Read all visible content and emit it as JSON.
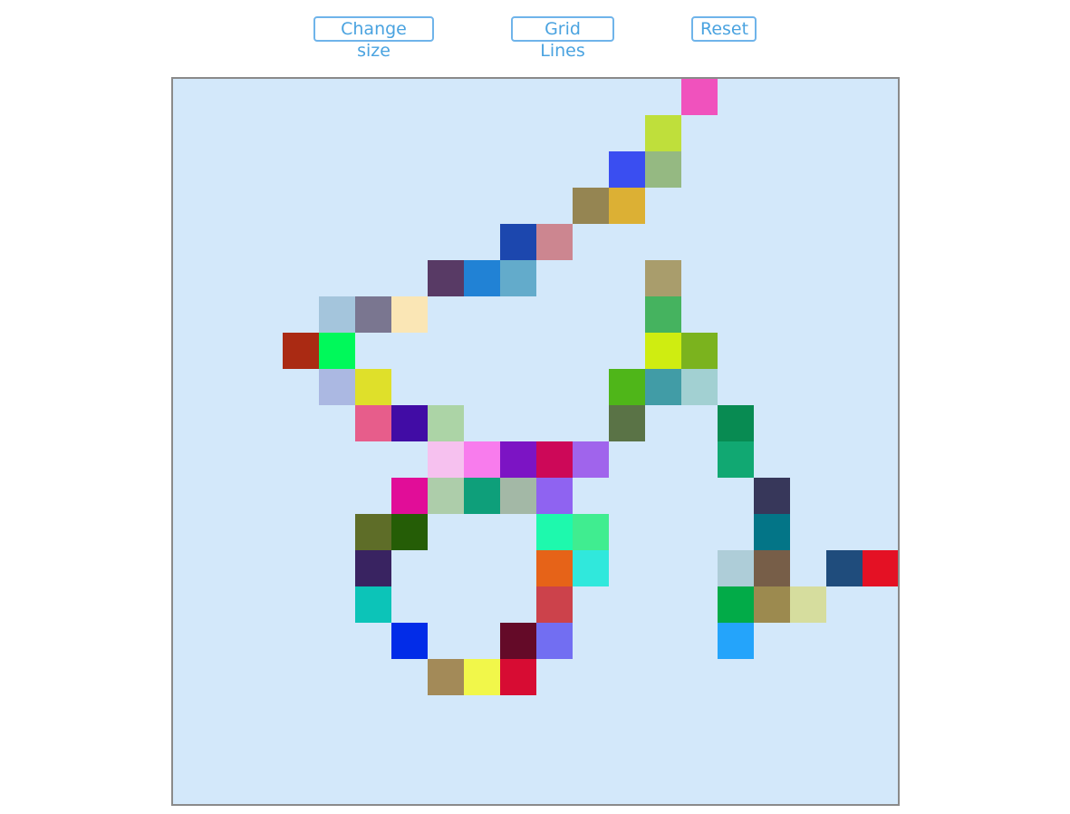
{
  "toolbar": {
    "change_size_label": "Change size",
    "grid_lines_label": "Grid Lines",
    "reset_label": "Reset"
  },
  "canvas": {
    "background_color": "#d3e8fa",
    "border_color": "#8a8a8a",
    "columns": 20,
    "rows": 20,
    "grid_lines": false,
    "painted_cells": [
      {
        "col": 14,
        "row": 0,
        "color": "#f052bd"
      },
      {
        "col": 13,
        "row": 1,
        "color": "#bfdf3b"
      },
      {
        "col": 12,
        "row": 2,
        "color": "#3a4ef1"
      },
      {
        "col": 13,
        "row": 2,
        "color": "#95b982"
      },
      {
        "col": 11,
        "row": 3,
        "color": "#958552"
      },
      {
        "col": 12,
        "row": 3,
        "color": "#dcb034"
      },
      {
        "col": 9,
        "row": 4,
        "color": "#1c47ae"
      },
      {
        "col": 10,
        "row": 4,
        "color": "#cc8690"
      },
      {
        "col": 7,
        "row": 5,
        "color": "#583a65"
      },
      {
        "col": 8,
        "row": 5,
        "color": "#2182d5"
      },
      {
        "col": 9,
        "row": 5,
        "color": "#63abcb"
      },
      {
        "col": 13,
        "row": 5,
        "color": "#a99d6c"
      },
      {
        "col": 4,
        "row": 6,
        "color": "#a4c5dc"
      },
      {
        "col": 5,
        "row": 6,
        "color": "#7a7690"
      },
      {
        "col": 6,
        "row": 6,
        "color": "#fae6b5"
      },
      {
        "col": 13,
        "row": 6,
        "color": "#45b35f"
      },
      {
        "col": 3,
        "row": 7,
        "color": "#aa2a13"
      },
      {
        "col": 4,
        "row": 7,
        "color": "#00f95a"
      },
      {
        "col": 13,
        "row": 7,
        "color": "#cfed11"
      },
      {
        "col": 14,
        "row": 7,
        "color": "#7bb31e"
      },
      {
        "col": 4,
        "row": 8,
        "color": "#abb8e2"
      },
      {
        "col": 5,
        "row": 8,
        "color": "#dfe02a"
      },
      {
        "col": 12,
        "row": 8,
        "color": "#4fb619"
      },
      {
        "col": 13,
        "row": 8,
        "color": "#419ca6"
      },
      {
        "col": 14,
        "row": 8,
        "color": "#a2d0d2"
      },
      {
        "col": 5,
        "row": 9,
        "color": "#e75d8b"
      },
      {
        "col": 6,
        "row": 9,
        "color": "#410ca5"
      },
      {
        "col": 7,
        "row": 9,
        "color": "#acd4a6"
      },
      {
        "col": 12,
        "row": 9,
        "color": "#5a7346"
      },
      {
        "col": 15,
        "row": 9,
        "color": "#088b52"
      },
      {
        "col": 7,
        "row": 10,
        "color": "#f6c1ef"
      },
      {
        "col": 8,
        "row": 10,
        "color": "#f87ced"
      },
      {
        "col": 9,
        "row": 10,
        "color": "#7c14c4"
      },
      {
        "col": 10,
        "row": 10,
        "color": "#cd0858"
      },
      {
        "col": 11,
        "row": 10,
        "color": "#a064ec"
      },
      {
        "col": 15,
        "row": 10,
        "color": "#11a872"
      },
      {
        "col": 6,
        "row": 11,
        "color": "#e10d98"
      },
      {
        "col": 7,
        "row": 11,
        "color": "#adcdaa"
      },
      {
        "col": 8,
        "row": 11,
        "color": "#0e9f7a"
      },
      {
        "col": 9,
        "row": 11,
        "color": "#a3b8a6"
      },
      {
        "col": 10,
        "row": 11,
        "color": "#8f63f1"
      },
      {
        "col": 16,
        "row": 11,
        "color": "#37375a"
      },
      {
        "col": 5,
        "row": 12,
        "color": "#5e6d28"
      },
      {
        "col": 6,
        "row": 12,
        "color": "#255d06"
      },
      {
        "col": 10,
        "row": 12,
        "color": "#1ef9ad"
      },
      {
        "col": 11,
        "row": 12,
        "color": "#40ed90"
      },
      {
        "col": 16,
        "row": 12,
        "color": "#037587"
      },
      {
        "col": 5,
        "row": 13,
        "color": "#392361"
      },
      {
        "col": 10,
        "row": 13,
        "color": "#e66318"
      },
      {
        "col": 11,
        "row": 13,
        "color": "#30e8dc"
      },
      {
        "col": 15,
        "row": 13,
        "color": "#aecdd8"
      },
      {
        "col": 16,
        "row": 13,
        "color": "#775e48"
      },
      {
        "col": 18,
        "row": 13,
        "color": "#1f4c7c"
      },
      {
        "col": 19,
        "row": 13,
        "color": "#e41124"
      },
      {
        "col": 5,
        "row": 14,
        "color": "#0cc4b8"
      },
      {
        "col": 10,
        "row": 14,
        "color": "#cc424b"
      },
      {
        "col": 15,
        "row": 14,
        "color": "#02ab48"
      },
      {
        "col": 16,
        "row": 14,
        "color": "#9c8a4f"
      },
      {
        "col": 17,
        "row": 14,
        "color": "#d6dd9e"
      },
      {
        "col": 6,
        "row": 15,
        "color": "#022ce8"
      },
      {
        "col": 9,
        "row": 15,
        "color": "#640a28"
      },
      {
        "col": 10,
        "row": 15,
        "color": "#726ef2"
      },
      {
        "col": 15,
        "row": 15,
        "color": "#24a4fb"
      },
      {
        "col": 7,
        "row": 16,
        "color": "#a38a58"
      },
      {
        "col": 8,
        "row": 16,
        "color": "#f1f74a"
      },
      {
        "col": 9,
        "row": 16,
        "color": "#d70c33"
      }
    ]
  }
}
